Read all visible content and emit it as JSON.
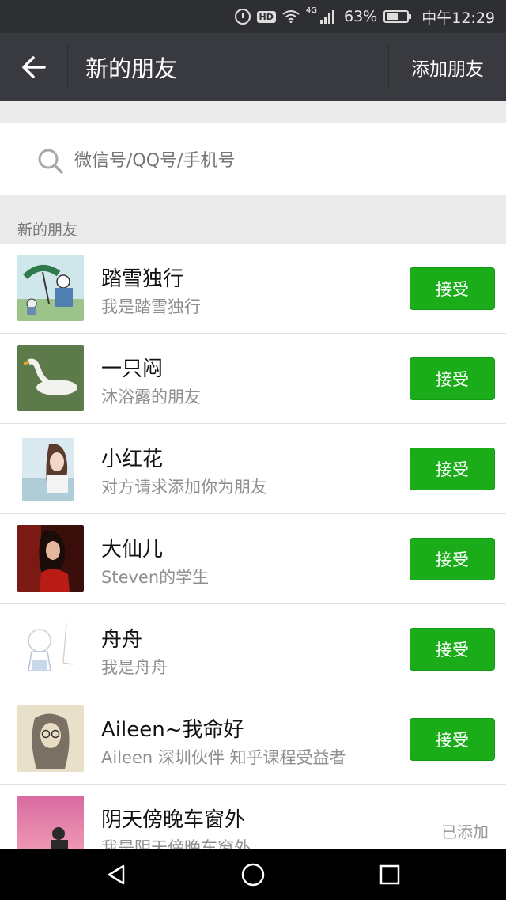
{
  "status_bar": {
    "battery_text": "63%",
    "battery_level": 0.63,
    "network_label": "4G",
    "hd_label": "HD",
    "time": "中午12:29"
  },
  "header": {
    "title": "新的朋友",
    "add_friend_label": "添加朋友"
  },
  "search": {
    "placeholder": "微信号/QQ号/手机号"
  },
  "section_label": "新的朋友",
  "friends": [
    {
      "name": "踏雪独行",
      "message": "我是踏雪独行",
      "action": "接受"
    },
    {
      "name": "一只闷",
      "message": "沐浴露的朋友",
      "action": "接受"
    },
    {
      "name": "小红花",
      "message": "对方请求添加你为朋友",
      "action": "接受"
    },
    {
      "name": "大仙儿",
      "message": "Steven的学生",
      "action": "接受"
    },
    {
      "name": "舟舟",
      "message": "我是舟舟",
      "action": "接受"
    },
    {
      "name": "Aileen~我命好",
      "message": "Aileen  深圳伙伴 知乎课程受益者",
      "action": "接受"
    },
    {
      "name": "阴天傍晚车窗外",
      "message": "我是阴天傍晚车窗外",
      "status": "已添加"
    }
  ],
  "colors": {
    "accent_green": "#1aad19",
    "title_bar": "#393a3f",
    "status_bar": "#2e2f32"
  },
  "icons": {
    "back": "arrow-left-icon",
    "search": "search-icon",
    "nav_back": "triangle-back-icon",
    "nav_home": "circle-home-icon",
    "nav_recent": "square-recent-icon"
  }
}
